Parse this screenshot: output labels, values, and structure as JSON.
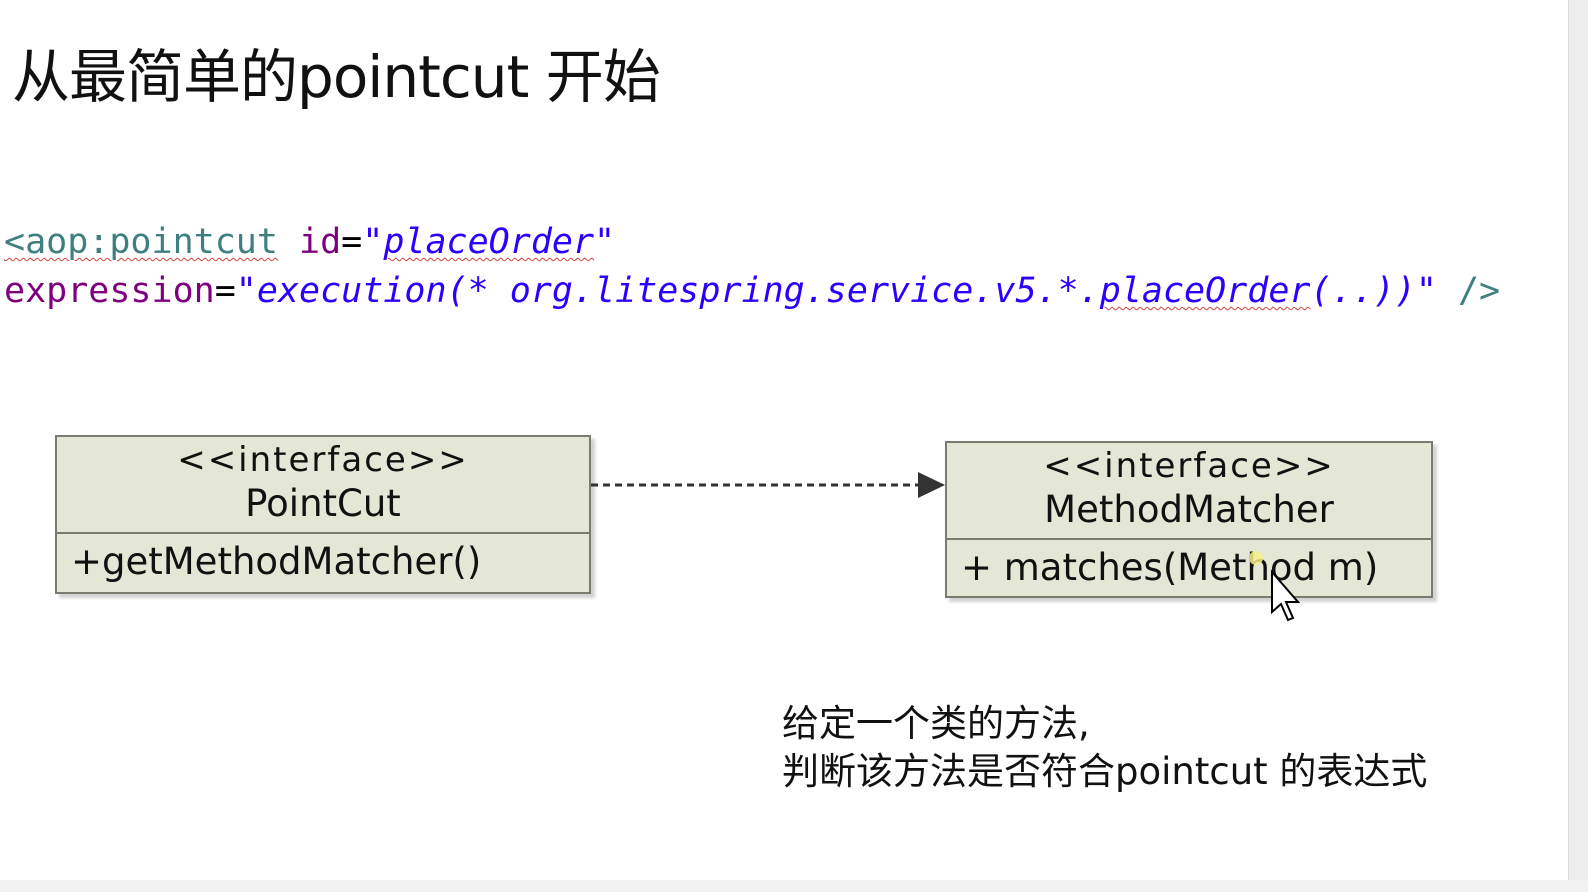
{
  "slide": {
    "title": "从最简单的pointcut 开始"
  },
  "code": {
    "line1": {
      "tag_open": "<aop:pointcut",
      "attr_id": "id",
      "eq": "=",
      "quote_open": "\"",
      "id_value": "placeOrder",
      "quote_close": "\""
    },
    "line2": {
      "attr_expression": "expression",
      "eq": "=",
      "expr_prefix": "\"execution(* org.litespring.service.v5.*.",
      "expr_method": "placeOrder",
      "expr_suffix": "(..))\"",
      "tag_close": " />"
    }
  },
  "uml": {
    "pointcut": {
      "stereotype": "<<interface>>",
      "name": "PointCut",
      "operation": "+getMethodMatcher()"
    },
    "method_matcher": {
      "stereotype": "<<interface>>",
      "name": "MethodMatcher",
      "operation": "+ matches(Method m)"
    }
  },
  "note": {
    "line1": "给定一个类的方法,",
    "line2": "判断该方法是否符合pointcut 的表达式"
  },
  "colors": {
    "box_fill": "#e4e6d6",
    "box_border": "#7a7a70",
    "xml_tag": "#3f7f7f",
    "xml_attr": "#7f007f",
    "xml_value": "#2a00ff",
    "arrow": "#333333"
  }
}
